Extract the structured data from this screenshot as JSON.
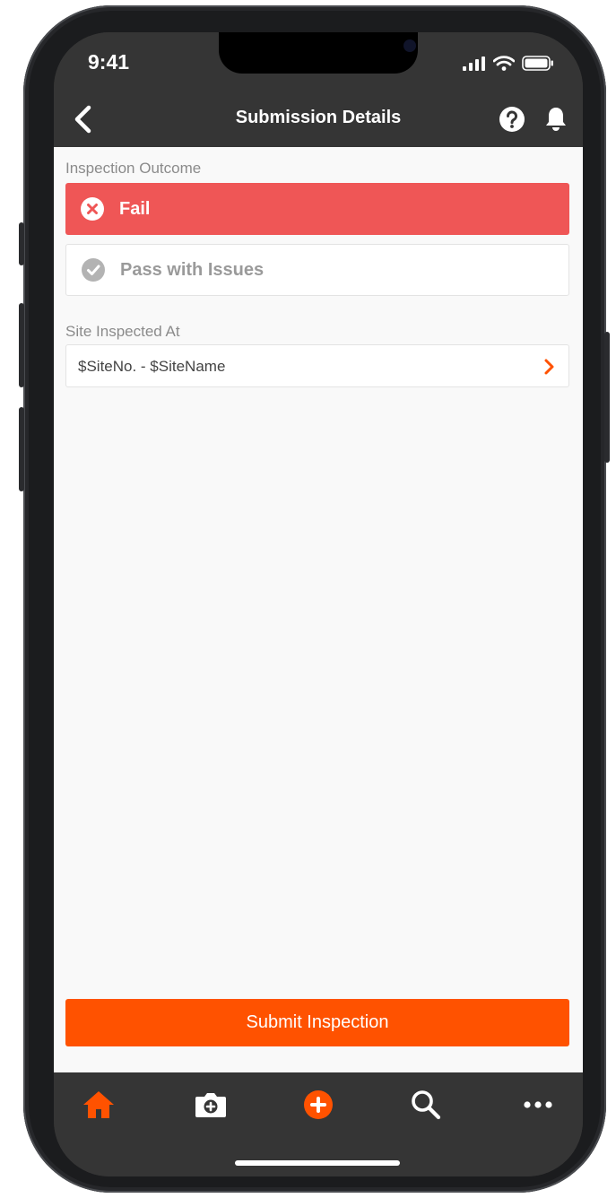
{
  "status_bar": {
    "time": "9:41"
  },
  "header": {
    "title": "Submission Details"
  },
  "outcome": {
    "label": "Inspection Outcome",
    "options": [
      {
        "label": "Fail",
        "selected": true,
        "color": "#ef5656"
      },
      {
        "label": "Pass with Issues",
        "selected": false
      }
    ]
  },
  "site": {
    "label": "Site Inspected At",
    "value": "$SiteNo. - $SiteName"
  },
  "submit_label": "Submit Inspection",
  "colors": {
    "accent": "#ff5200",
    "nav_background": "#353535",
    "fail": "#ef5656"
  },
  "tab_bar": {
    "items": [
      {
        "icon": "home-icon",
        "active": true
      },
      {
        "icon": "camera-icon",
        "active": false
      },
      {
        "icon": "add-icon",
        "active": false
      },
      {
        "icon": "search-icon",
        "active": false
      },
      {
        "icon": "more-icon",
        "active": false
      }
    ]
  }
}
